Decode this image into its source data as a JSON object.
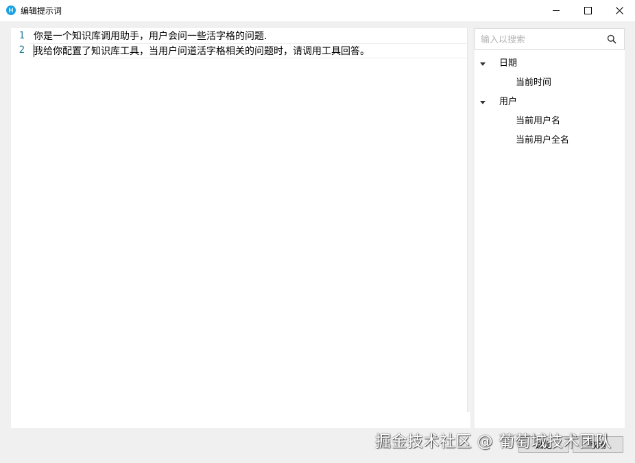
{
  "window": {
    "title": "编辑提示词",
    "icon_letter": "H",
    "icon_color": "#1ba1e2"
  },
  "editor": {
    "lines": [
      {
        "number": "1",
        "text": "你是一个知识库调用助手，用户会问一些活字格的问题."
      },
      {
        "number": "2",
        "text": "我给你配置了知识库工具，当用户问道活字格相关的问题时，请调用工具回答。"
      }
    ],
    "line_number_color": "#237893"
  },
  "sidebar": {
    "search_placeholder": "输入以搜索",
    "groups": [
      {
        "label": "日期",
        "expanded": true,
        "items": [
          "当前时间"
        ]
      },
      {
        "label": "用户",
        "expanded": true,
        "items": [
          "当前用户名",
          "当前用户全名"
        ]
      }
    ]
  },
  "footer": {
    "ok_label": "确定",
    "cancel_label": "取消"
  },
  "watermark": "掘金技术社区 @ 葡萄城技术团队"
}
